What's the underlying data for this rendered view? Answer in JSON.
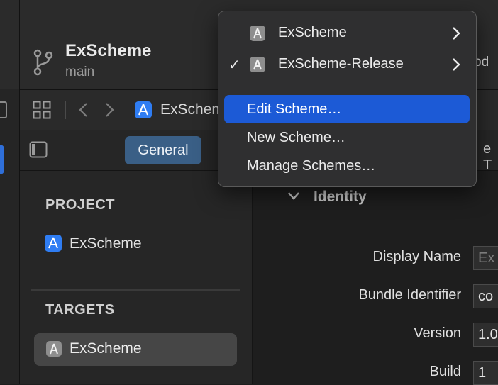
{
  "toolbar": {
    "project_title": "ExScheme",
    "branch": "main",
    "right_text": "od"
  },
  "jump_bar": {
    "path_label": "ExScheme"
  },
  "editor_tabs": {
    "general": "General",
    "right_partial": "e T"
  },
  "sidebar": {
    "project_header": "PROJECT",
    "project_item": "ExScheme",
    "targets_header": "TARGETS",
    "target_item": "ExScheme"
  },
  "identity": {
    "section_title": "Identity",
    "fields": {
      "display_name": {
        "label": "Display Name",
        "value": "Ex"
      },
      "bundle_identifier": {
        "label": "Bundle Identifier",
        "value": "co"
      },
      "version": {
        "label": "Version",
        "value": "1.0"
      },
      "build": {
        "label": "Build",
        "value": "1"
      }
    }
  },
  "scheme_menu": {
    "schemes": [
      {
        "label": "ExScheme",
        "checked": false
      },
      {
        "label": "ExScheme-Release",
        "checked": true
      }
    ],
    "check_glyph": "✓",
    "actions": [
      {
        "label": "Edit Scheme…",
        "highlighted": true
      },
      {
        "label": "New Scheme…",
        "highlighted": false
      },
      {
        "label": "Manage Schemes…",
        "highlighted": false
      }
    ]
  },
  "colors": {
    "accent": "#1c5ad6",
    "tab_selected": "#3a5f86"
  },
  "icons": [
    "branch-icon",
    "grid-icon",
    "back-icon",
    "forward-icon",
    "app-icon",
    "sidebar-toggle-icon",
    "chevron-right-icon",
    "chevron-down-icon",
    "checkmark-icon"
  ]
}
